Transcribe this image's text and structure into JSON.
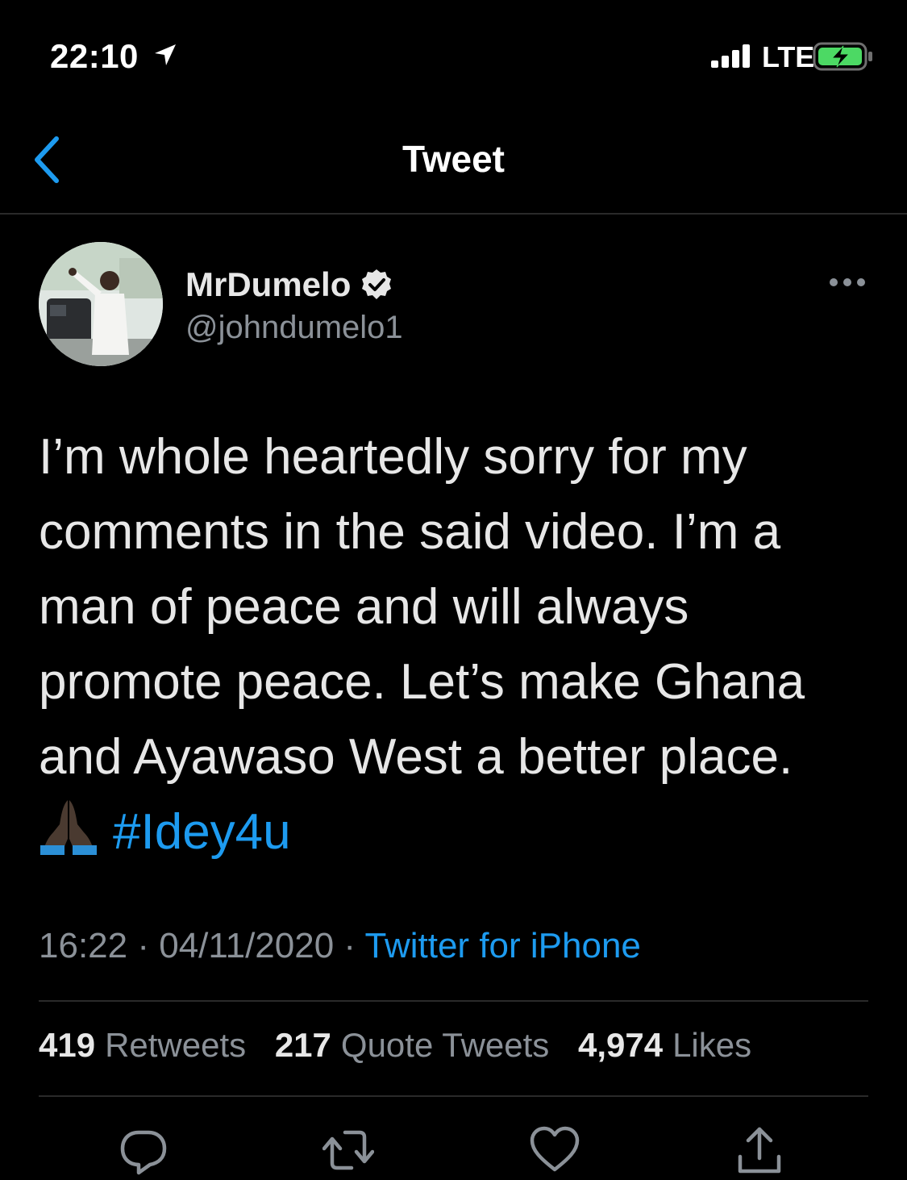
{
  "status_bar": {
    "time": "22:10",
    "network": "LTE",
    "icons": [
      "location-arrow-icon",
      "signal-bars-icon",
      "battery-charging-icon"
    ]
  },
  "nav": {
    "title": "Tweet",
    "back_icon": "chevron-left-icon"
  },
  "author": {
    "display_name": "MrDumelo",
    "handle": "@johndumelo1",
    "verified": true
  },
  "tweet": {
    "lines": [
      "I’m whole heartedly sorry for my",
      "comments in the said video. I’m a",
      "man of peace and will always",
      "promote peace. Let’s make Ghana",
      "and Ayawaso West a better place."
    ],
    "emoji": "folded-hands-emoji",
    "hashtag": "#Idey4u"
  },
  "meta": {
    "time": "16:22",
    "date": "04/11/2020",
    "separator": "·",
    "source": "Twitter for iPhone"
  },
  "stats": {
    "retweets_count": "419",
    "retweets_label": "Retweets",
    "quotes_count": "217",
    "quotes_label": "Quote Tweets",
    "likes_count": "4,974",
    "likes_label": "Likes"
  },
  "actions": [
    "reply-icon",
    "retweet-icon",
    "like-icon",
    "share-icon"
  ],
  "colors": {
    "background": "#000000",
    "accent": "#1d9bf0",
    "text": "#e7e7e7",
    "muted": "#8b9198",
    "battery_green": "#4cd964",
    "divider": "#2a2a2a"
  }
}
